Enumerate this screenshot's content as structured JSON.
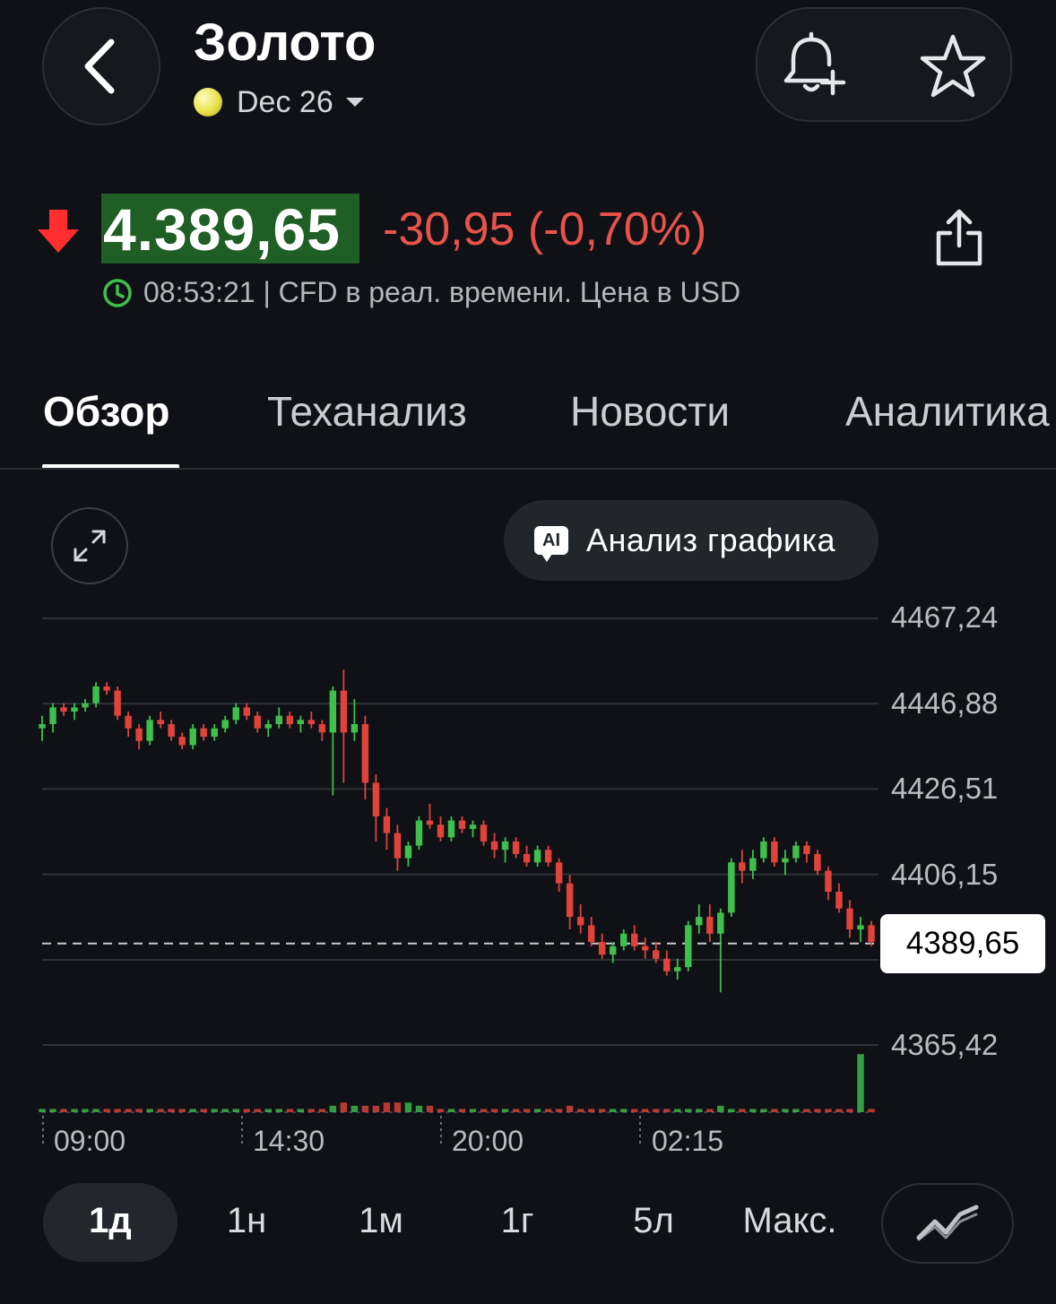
{
  "header": {
    "title": "Золото",
    "contract": "Dec 26"
  },
  "quote": {
    "price": "4.389,65",
    "change": "-30,95 (-0,70%)",
    "info": "08:53:21 | CFD в реал. времени. Цена в USD",
    "direction": "down"
  },
  "tabs": [
    "Обзор",
    "Теханализ",
    "Новости",
    "Аналитика"
  ],
  "active_tab": "Обзор",
  "ai_button_label": "Анализ графика",
  "ai_badge": "AI",
  "chart_data": {
    "type": "candlestick",
    "y_ticks": [
      "4467,24",
      "4446,88",
      "4426,51",
      "4406,15",
      "4365,42"
    ],
    "x_ticks": [
      "09:00",
      "14:30",
      "20:00",
      "02:15"
    ],
    "last_price_label": "4389,65",
    "ylim": [
      4357,
      4472
    ],
    "candles": [
      [
        4441,
        4444,
        4438,
        4442
      ],
      [
        4442,
        4447,
        4440,
        4446
      ],
      [
        4446,
        4447,
        4444,
        4445
      ],
      [
        4445,
        4447,
        4443,
        4446
      ],
      [
        4446,
        4448,
        4445,
        4447
      ],
      [
        4447,
        4452,
        4446,
        4451
      ],
      [
        4451,
        4452,
        4449,
        4450
      ],
      [
        4450,
        4451,
        4443,
        4444
      ],
      [
        4444,
        4445,
        4439,
        4441
      ],
      [
        4441,
        4442,
        4436,
        4438
      ],
      [
        4438,
        4444,
        4437,
        4443
      ],
      [
        4443,
        4445,
        4441,
        4442
      ],
      [
        4442,
        4443,
        4438,
        4439
      ],
      [
        4439,
        4440,
        4436,
        4437
      ],
      [
        4437,
        4442,
        4436,
        4441
      ],
      [
        4441,
        4442,
        4438,
        4439
      ],
      [
        4439,
        4442,
        4438,
        4441
      ],
      [
        4441,
        4444,
        4440,
        4443
      ],
      [
        4443,
        4447,
        4442,
        4446
      ],
      [
        4446,
        4447,
        4443,
        4444
      ],
      [
        4444,
        4445,
        4440,
        4441
      ],
      [
        4441,
        4443,
        4439,
        4442
      ],
      [
        4442,
        4446,
        4441,
        4444
      ],
      [
        4444,
        4445,
        4441,
        4442
      ],
      [
        4442,
        4444,
        4440,
        4443
      ],
      [
        4443,
        4445,
        4441,
        4442
      ],
      [
        4442,
        4443,
        4438,
        4440
      ],
      [
        4440,
        4451,
        4425,
        4450
      ],
      [
        4450,
        4455,
        4428,
        4440
      ],
      [
        4440,
        4448,
        4438,
        4442
      ],
      [
        4442,
        4444,
        4424,
        4428
      ],
      [
        4428,
        4430,
        4414,
        4420
      ],
      [
        4420,
        4422,
        4412,
        4416
      ],
      [
        4416,
        4418,
        4407,
        4410
      ],
      [
        4410,
        4414,
        4408,
        4413
      ],
      [
        4413,
        4420,
        4412,
        4419
      ],
      [
        4419,
        4423,
        4417,
        4418
      ],
      [
        4418,
        4420,
        4414,
        4415
      ],
      [
        4415,
        4420,
        4414,
        4419
      ],
      [
        4419,
        4420,
        4416,
        4417
      ],
      [
        4417,
        4419,
        4415,
        4418
      ],
      [
        4418,
        4419,
        4413,
        4414
      ],
      [
        4414,
        4416,
        4410,
        4412
      ],
      [
        4412,
        4415,
        4409,
        4414
      ],
      [
        4414,
        4415,
        4410,
        4411
      ],
      [
        4411,
        4413,
        4408,
        4409
      ],
      [
        4409,
        4413,
        4408,
        4412
      ],
      [
        4412,
        4413,
        4408,
        4409
      ],
      [
        4409,
        4410,
        4402,
        4404
      ],
      [
        4404,
        4406,
        4393,
        4396
      ],
      [
        4396,
        4399,
        4392,
        4394
      ],
      [
        4394,
        4396,
        4389,
        4390
      ],
      [
        4390,
        4392,
        4386,
        4387
      ],
      [
        4387,
        4390,
        4385,
        4389
      ],
      [
        4389,
        4393,
        4388,
        4392
      ],
      [
        4392,
        4394,
        4388,
        4389
      ],
      [
        4389,
        4391,
        4386,
        4388
      ],
      [
        4388,
        4390,
        4385,
        4386
      ],
      [
        4386,
        4388,
        4382,
        4383
      ],
      [
        4383,
        4386,
        4381,
        4384
      ],
      [
        4384,
        4395,
        4383,
        4394
      ],
      [
        4394,
        4399,
        4392,
        4396
      ],
      [
        4396,
        4399,
        4390,
        4392
      ],
      [
        4392,
        4398,
        4378,
        4397
      ],
      [
        4397,
        4410,
        4396,
        4409
      ],
      [
        4409,
        4412,
        4404,
        4407
      ],
      [
        4407,
        4412,
        4405,
        4410
      ],
      [
        4410,
        4415,
        4409,
        4414
      ],
      [
        4414,
        4415,
        4408,
        4409
      ],
      [
        4409,
        4412,
        4406,
        4410
      ],
      [
        4410,
        4414,
        4409,
        4413
      ],
      [
        4413,
        4414,
        4409,
        4411
      ],
      [
        4411,
        4412,
        4406,
        4407
      ],
      [
        4407,
        4408,
        4400,
        4402
      ],
      [
        4402,
        4404,
        4397,
        4398
      ],
      [
        4398,
        4400,
        4391,
        4393
      ],
      [
        4393,
        4396,
        4390,
        4394
      ],
      [
        4394,
        4395,
        4389,
        4390
      ]
    ],
    "volume": [
      1,
      1,
      1,
      1,
      1,
      1,
      1,
      1,
      1,
      1,
      1,
      1,
      1,
      1,
      1,
      1,
      1,
      1,
      1,
      1,
      1,
      1,
      1,
      1,
      1,
      1,
      1,
      2,
      3,
      2,
      2,
      2,
      3,
      3,
      3,
      2,
      2,
      1,
      1,
      1,
      1,
      1,
      1,
      1,
      1,
      1,
      1,
      1,
      1,
      2,
      1,
      1,
      1,
      1,
      1,
      1,
      1,
      1,
      1,
      1,
      1,
      1,
      1,
      2,
      1,
      1,
      1,
      1,
      1,
      1,
      1,
      1,
      1,
      1,
      1,
      1,
      18,
      1
    ],
    "colors": {
      "up": "#3fbf4b",
      "down": "#e0433a"
    }
  },
  "range_buttons": [
    "1д",
    "1н",
    "1м",
    "1г",
    "5л",
    "Макс."
  ],
  "active_range": "1д",
  "colors": {
    "price_highlight": "#1f5e24",
    "change_red": "#e8534a",
    "clock_green": "#3fbf4b",
    "arrow_red": "#ff2e2e"
  }
}
